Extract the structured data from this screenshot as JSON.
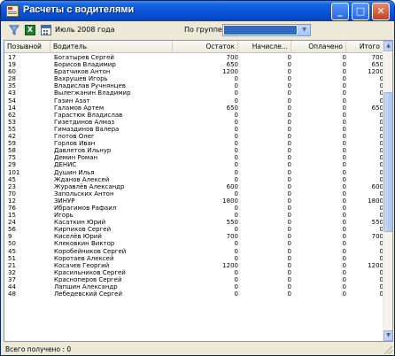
{
  "window": {
    "title": "Расчеты с водителями",
    "buttons": {
      "minimize": "_",
      "maximize": "□",
      "close": "✕"
    }
  },
  "toolbar": {
    "filter_icon": "filter-icon",
    "excel_icon": "excel-icon",
    "excel_glyph": "X",
    "calendar_icon": "calendar-icon",
    "period": "Июль 2008 года",
    "group_label": "По группе",
    "group_value": ""
  },
  "grid": {
    "columns": [
      "Позывной",
      "Водитель",
      "Остаток",
      "Начисле...",
      "Оплачено",
      "Итого"
    ],
    "rows": [
      [
        "17",
        "Богатырев Сергей",
        "700",
        "0",
        "0",
        "700"
      ],
      [
        "19",
        "Борисов Владимир",
        "650",
        "0",
        "0",
        "650"
      ],
      [
        "60",
        "Братчиков Антон",
        "1200",
        "0",
        "0",
        "1200"
      ],
      [
        "28",
        "Вахрушев Игорь",
        "0",
        "0",
        "0",
        "0"
      ],
      [
        "35",
        "Владислав Ручнянцев",
        "0",
        "0",
        "0",
        "0"
      ],
      [
        "43",
        "Вылегжанин Владимир",
        "0",
        "0",
        "0",
        "0"
      ],
      [
        "54",
        "Газин Азат",
        "0",
        "0",
        "0",
        "0"
      ],
      [
        "14",
        "Галамов Артем",
        "650",
        "0",
        "0",
        "650"
      ],
      [
        "62",
        "Гарастюк Владислав",
        "0",
        "0",
        "0",
        "0"
      ],
      [
        "53",
        "Гизетдинов Алмаз",
        "0",
        "0",
        "0",
        "0"
      ],
      [
        "55",
        "Гимаздинов Валера",
        "0",
        "0",
        "0",
        "0"
      ],
      [
        "42",
        "Глотов Олег",
        "0",
        "0",
        "0",
        "0"
      ],
      [
        "59",
        "Горлов Иван",
        "0",
        "0",
        "0",
        "0"
      ],
      [
        "58",
        "Давлетов Ильнур",
        "0",
        "0",
        "0",
        "0"
      ],
      [
        "75",
        "Демин Роман",
        "0",
        "0",
        "0",
        "0"
      ],
      [
        "29",
        "ДЕНИС",
        "0",
        "0",
        "0",
        "0"
      ],
      [
        "101",
        "Душин Илья",
        "0",
        "0",
        "0",
        "0"
      ],
      [
        "45",
        "Жданов Алексей",
        "0",
        "0",
        "0",
        "0"
      ],
      [
        "23",
        "Журавлёв Александр",
        "600",
        "0",
        "0",
        "600"
      ],
      [
        "70",
        "Запольских Антон",
        "0",
        "0",
        "0",
        "0"
      ],
      [
        "12",
        "ЗИНУР",
        "1800",
        "0",
        "0",
        "1800"
      ],
      [
        "76",
        "Ибрагимов Рафаил",
        "0",
        "0",
        "0",
        "0"
      ],
      [
        "15",
        "Игорь",
        "0",
        "0",
        "0",
        "0"
      ],
      [
        "24",
        "Касаткин Юрий",
        "550",
        "0",
        "0",
        "550"
      ],
      [
        "56",
        "Кирпиков Сергей",
        "0",
        "0",
        "0",
        "0"
      ],
      [
        "9",
        "Киселёв Юрий",
        "700",
        "0",
        "0",
        "700"
      ],
      [
        "50",
        "Клековкин Виктор",
        "0",
        "0",
        "0",
        "0"
      ],
      [
        "45",
        "Коробейников Сергей",
        "0",
        "0",
        "0",
        "0"
      ],
      [
        "51",
        "Коротаев Алексей",
        "0",
        "0",
        "0",
        "0"
      ],
      [
        "21",
        "Косачев Георгий",
        "1200",
        "0",
        "0",
        "1200"
      ],
      [
        "32",
        "Красильников Сергей",
        "0",
        "0",
        "0",
        "0"
      ],
      [
        "37",
        "Красноперов Сергей",
        "0",
        "0",
        "0",
        "0"
      ],
      [
        "44",
        "Лапшин Александр",
        "0",
        "0",
        "0",
        "0"
      ],
      [
        "48",
        "Лебедевский Сергей",
        "0",
        "0",
        "0",
        "0"
      ]
    ]
  },
  "scrollbar": {
    "up_icon": "▲",
    "down_icon": "▼"
  },
  "status": {
    "text": "Всего получено : 0"
  }
}
